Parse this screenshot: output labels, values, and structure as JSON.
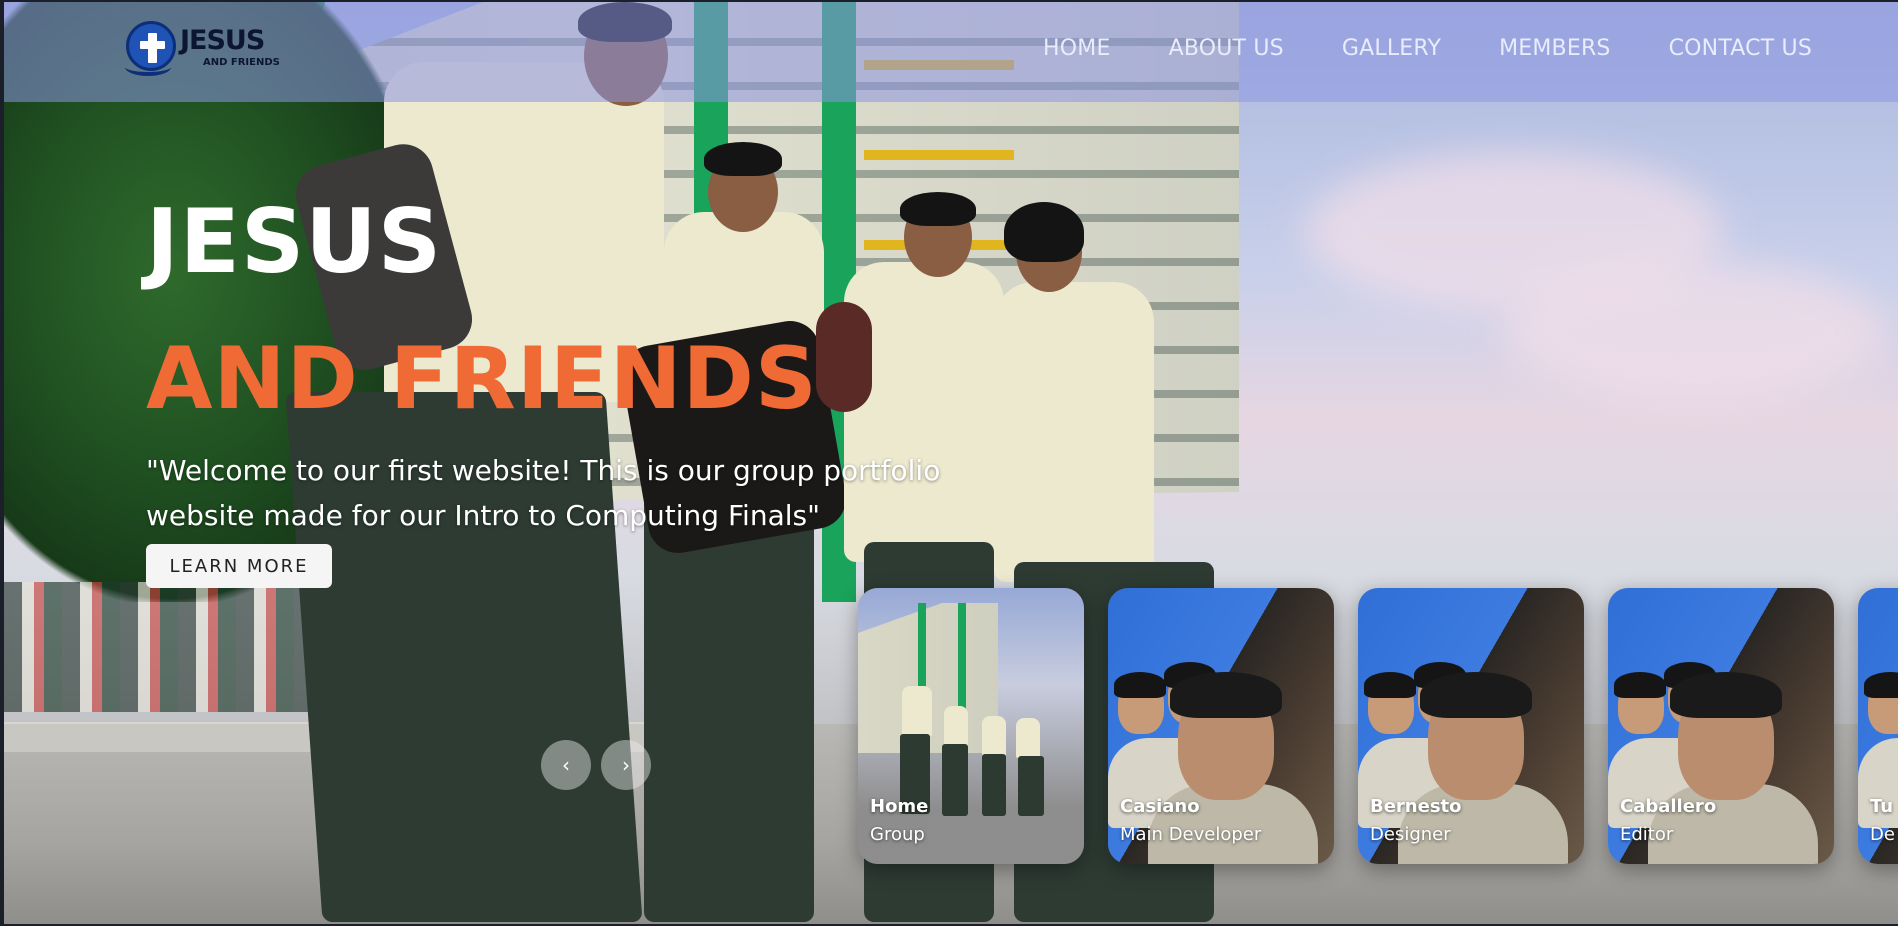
{
  "nav": {
    "logo_title": "JESUS",
    "logo_subtitle": "AND FRIENDS",
    "links": [
      "HOME",
      "ABOUT US",
      "GALLERY",
      "MEMBERS",
      "CONTACT US"
    ]
  },
  "hero": {
    "title_line1": "JESUS",
    "title_line2": "AND FRIENDS",
    "description": "\"Welcome to our first website! This is our group portfolio website made for our Intro to Computing Finals\"",
    "cta_label": "LEARN MORE",
    "prev_arrow": "‹",
    "next_arrow": "›"
  },
  "thumbnails": [
    {
      "name": "Home",
      "role": "Group"
    },
    {
      "name": "Casiano",
      "role": "Main Developer"
    },
    {
      "name": "Bernesto",
      "role": "Designer"
    },
    {
      "name": "Caballero",
      "role": "Editor"
    },
    {
      "name": "Tu",
      "role": "De"
    }
  ],
  "colors": {
    "accent_orange": "#f06a35",
    "nav_overlay": "#8c96e1",
    "logo_blue": "#1f53b5"
  },
  "icons": {
    "logo": "cross-badge-icon",
    "prev": "chevron-left-icon",
    "next": "chevron-right-icon"
  }
}
